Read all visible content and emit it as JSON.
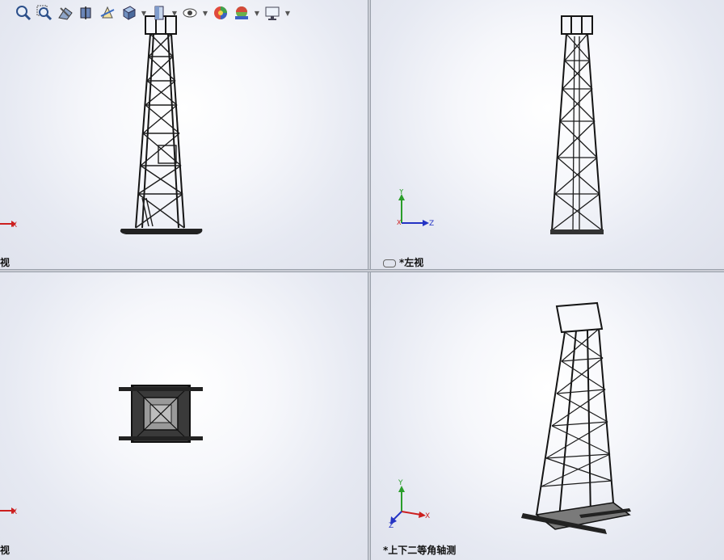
{
  "viewports": {
    "front": {
      "label": "视"
    },
    "left": {
      "label": "*左视"
    },
    "top": {
      "label": "视"
    },
    "iso": {
      "label": "*上下二等角轴测"
    }
  },
  "triad": {
    "x": "X",
    "y": "Y",
    "z": "Z"
  },
  "toolbar": {
    "icons": [
      "zoom-to-fit-icon",
      "zoom-to-area-icon",
      "previous-view-icon",
      "section-view-icon",
      "dynamic-annotation-icon",
      "view-orientation-icon",
      "display-style-icon",
      "hide-show-icon",
      "edit-appearance-icon",
      "apply-scene-icon",
      "view-settings-icon"
    ]
  },
  "colors": {
    "axis_x": "#cc1f1f",
    "axis_y": "#2a9d2a",
    "axis_z": "#2433c4",
    "model": "#1a1a1a"
  }
}
